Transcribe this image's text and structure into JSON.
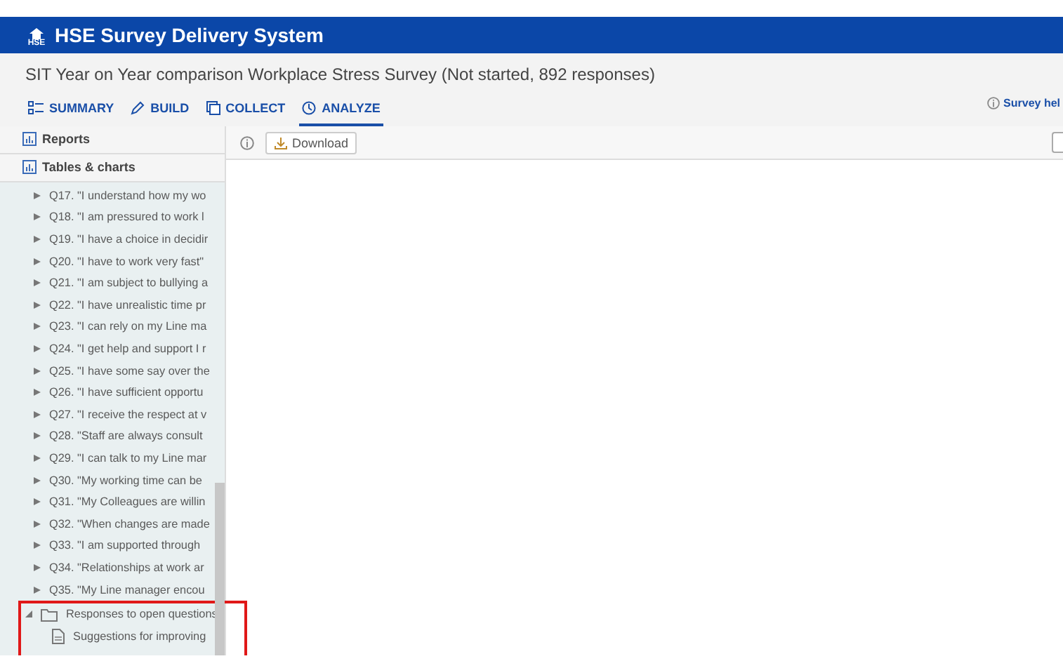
{
  "header": {
    "logo_text": "HSE",
    "title": "HSE Survey Delivery System"
  },
  "survey_title": "SIT Year on Year comparison Workplace Stress Survey (Not started, 892 responses)",
  "tabs": [
    {
      "label": "SUMMARY",
      "kind": "summary",
      "selected": false
    },
    {
      "label": "BUILD",
      "kind": "build",
      "selected": false
    },
    {
      "label": "COLLECT",
      "kind": "collect",
      "selected": false
    },
    {
      "label": "ANALYZE",
      "kind": "analyze",
      "selected": true
    }
  ],
  "help_link": "Survey hel",
  "sidebar": {
    "sections": [
      "Reports",
      "Tables & charts"
    ],
    "tree": [
      {
        "kind": "question",
        "label": "Q17. \"I understand how my wo",
        "expanded": false
      },
      {
        "kind": "question",
        "label": "Q18. \"I am pressured to work l",
        "expanded": false
      },
      {
        "kind": "question",
        "label": "Q19. \"I have a choice in decidir",
        "expanded": false
      },
      {
        "kind": "question",
        "label": "Q20. \"I have to work very fast\"",
        "expanded": false
      },
      {
        "kind": "question",
        "label": "Q21. \"I am subject to bullying a",
        "expanded": false
      },
      {
        "kind": "question",
        "label": "Q22. \"I have unrealistic time pr",
        "expanded": false
      },
      {
        "kind": "question",
        "label": "Q23. \"I can rely on my Line ma",
        "expanded": false
      },
      {
        "kind": "question",
        "label": "Q24. \"I get help and support I r",
        "expanded": false
      },
      {
        "kind": "question",
        "label": "Q25. \"I have some say over the",
        "expanded": false
      },
      {
        "kind": "question",
        "label": "Q26. \"I have sufficient opportu",
        "expanded": false
      },
      {
        "kind": "question",
        "label": "Q27. \"I receive the respect at v",
        "expanded": false
      },
      {
        "kind": "question",
        "label": "Q28. \"Staff are always consult",
        "expanded": false
      },
      {
        "kind": "question",
        "label": "Q29. \"I can talk to my Line mar",
        "expanded": false
      },
      {
        "kind": "question",
        "label": "Q30. \"My working time can be",
        "expanded": false
      },
      {
        "kind": "question",
        "label": "Q31. \"My Colleagues are willin",
        "expanded": false
      },
      {
        "kind": "question",
        "label": "Q32. \"When changes are made",
        "expanded": false
      },
      {
        "kind": "question",
        "label": "Q33. \"I am supported through",
        "expanded": false
      },
      {
        "kind": "question",
        "label": "Q34. \"Relationships at work ar",
        "expanded": false
      },
      {
        "kind": "question",
        "label": "Q35. \"My Line manager encou",
        "expanded": false
      },
      {
        "kind": "folder",
        "label": "Responses to open questions",
        "expanded": true,
        "children": [
          {
            "kind": "document",
            "label": "Suggestions for improving"
          }
        ]
      }
    ]
  },
  "toolbar": {
    "download": "Download"
  }
}
